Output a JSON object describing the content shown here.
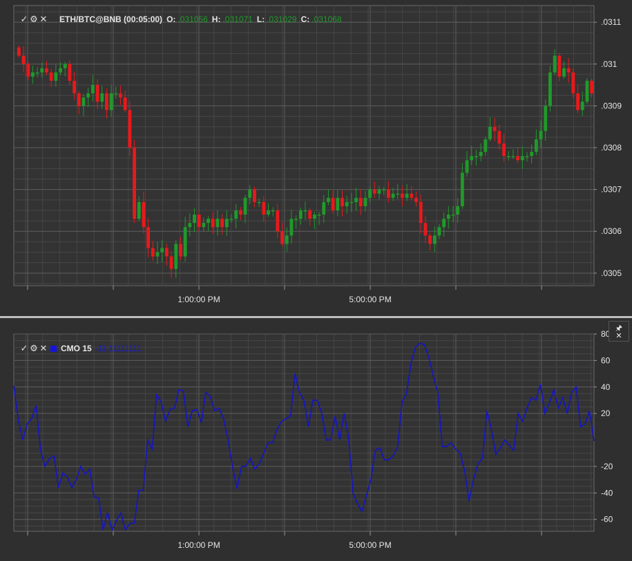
{
  "colors": {
    "background": "#2f2f2f",
    "plot_background": "#333333",
    "grid": "#5c5c5c",
    "axis_text": "#e6e6e6",
    "up": "#1f9a2a",
    "down": "#e8191c",
    "cmo_line": "#1414c8",
    "ohlc_value": "#1f9a2a",
    "cmo_value": "#1a1ad9"
  },
  "icons": {
    "check": "✓",
    "gear": "⚙",
    "close": "✕",
    "pin": "🖈"
  },
  "price_legend": {
    "title": "ETH/BTC@BNB (00:05:00)",
    "o_label": "O:",
    "o_value": ".031056",
    "h_label": "H:",
    "h_value": ".031071",
    "l_label": "L:",
    "l_value": ".031029",
    "c_label": "C:",
    "c_value": ".031068"
  },
  "cmo_legend": {
    "title": "CMO 15",
    "value": "-11.11111111"
  },
  "chart_data": [
    {
      "type": "candlestick",
      "title": "ETH/BTC@BNB (00:05:00)",
      "x_ticks": [
        "1:00:00 PM",
        "5:00:00 PM"
      ],
      "y_ticks": [
        ".0305",
        ".0306",
        ".0307",
        ".0308",
        ".0309",
        ".031",
        ".0311"
      ],
      "y_tick_values": [
        0.0305,
        0.0306,
        0.0307,
        0.0308,
        0.0309,
        0.031,
        0.0311
      ],
      "ylim": [
        0.03047,
        0.03114
      ],
      "grid": true,
      "closes": [
        0.03102,
        0.031,
        0.03097,
        0.03098,
        0.03098,
        0.03099,
        0.03098,
        0.03096,
        0.03098,
        0.03099,
        0.031,
        0.03096,
        0.03093,
        0.0309,
        0.03092,
        0.03093,
        0.03095,
        0.03091,
        0.03093,
        0.03089,
        0.03093,
        0.03093,
        0.03092,
        0.03089,
        0.0308,
        0.03063,
        0.03067,
        0.03061,
        0.03056,
        0.03054,
        0.03055,
        0.03056,
        0.03054,
        0.03051,
        0.03057,
        0.03054,
        0.03061,
        0.03062,
        0.03064,
        0.03061,
        0.03062,
        0.03063,
        0.03061,
        0.03063,
        0.03061,
        0.03063,
        0.03063,
        0.03065,
        0.03064,
        0.03068,
        0.0307,
        0.03067,
        0.03067,
        0.03064,
        0.03065,
        0.03065,
        0.0306,
        0.03057,
        0.03059,
        0.03063,
        0.03063,
        0.03065,
        0.03065,
        0.03063,
        0.03064,
        0.03064,
        0.03067,
        0.03068,
        0.03065,
        0.03068,
        0.03066,
        0.03067,
        0.03067,
        0.03068,
        0.03066,
        0.03068,
        0.0307,
        0.03069,
        0.0307,
        0.0307,
        0.03068,
        0.03069,
        0.03069,
        0.03068,
        0.03069,
        0.03068,
        0.03067,
        0.03062,
        0.03059,
        0.03057,
        0.03059,
        0.03061,
        0.03063,
        0.03064,
        0.03064,
        0.03066,
        0.03074,
        0.03077,
        0.03078,
        0.03078,
        0.03079,
        0.03082,
        0.03085,
        0.03084,
        0.03081,
        0.03078,
        0.03078,
        0.03078,
        0.03077,
        0.03078,
        0.03078,
        0.03079,
        0.03082,
        0.03084,
        0.0309,
        0.03098,
        0.03102,
        0.03097,
        0.03099,
        0.03098,
        0.03093,
        0.03089,
        0.03091,
        0.03096,
        0.03093
      ]
    },
    {
      "type": "line",
      "title": "CMO 15",
      "x_ticks": [
        "1:00:00 PM",
        "5:00:00 PM"
      ],
      "y_ticks": [
        "80",
        "60",
        "40",
        "20",
        "-20",
        "-40",
        "-60"
      ],
      "y_tick_values": [
        80,
        60,
        40,
        20,
        -20,
        -40,
        -60
      ],
      "ylim": [
        -69,
        80
      ],
      "grid": true,
      "series": [
        {
          "values": [
            41,
            15,
            0,
            12,
            16,
            26,
            -8,
            -20,
            -14,
            -12,
            -36,
            -25,
            -28,
            -36,
            -30,
            -20,
            -26,
            -22,
            -43,
            -44,
            -68,
            -55,
            -68,
            -61,
            -55,
            -68,
            -63,
            -63,
            -38,
            -38,
            0,
            -7,
            34,
            29,
            14,
            23,
            24,
            38,
            37,
            10,
            22,
            23,
            13,
            36,
            33,
            22,
            24,
            16,
            0,
            -20,
            -37,
            -20,
            -20,
            -14,
            -22,
            -18,
            -10,
            -2,
            -2,
            8,
            14,
            16,
            18,
            50,
            36,
            30,
            10,
            30,
            30,
            20,
            0,
            0,
            18,
            0,
            20,
            2,
            -40,
            -48,
            -54,
            -42,
            -30,
            -8,
            -6,
            -15,
            -15,
            -12,
            -5,
            29,
            35,
            58,
            70,
            73,
            72,
            62,
            48,
            36,
            -5,
            -5,
            -2,
            -7,
            -10,
            -23,
            -46,
            -30,
            -18,
            -14,
            22,
            8,
            -11,
            -6,
            0,
            -4,
            -8,
            20,
            14,
            24,
            32,
            30,
            42,
            20,
            28,
            38,
            24,
            32,
            20,
            36,
            40,
            10,
            12,
            22,
            -1
          ]
        }
      ]
    }
  ]
}
